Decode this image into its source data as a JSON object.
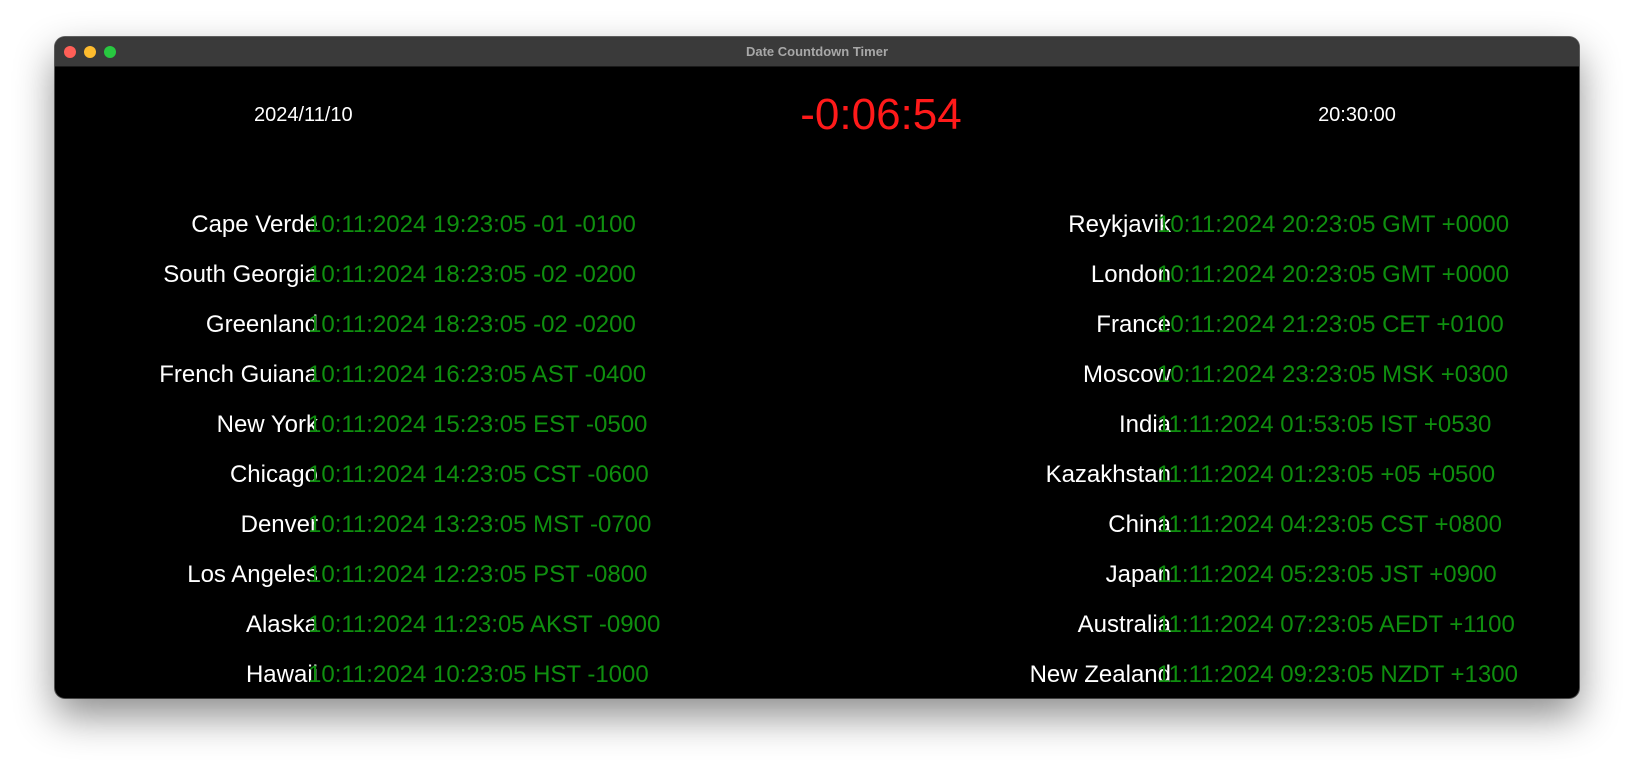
{
  "window": {
    "title": "Date Countdown Timer",
    "traffic_colors": {
      "close": "#ff5f57",
      "minimize": "#febc2e",
      "maximize": "#28c840"
    }
  },
  "header": {
    "date": "2024/11/10",
    "countdown": "-0:06:54",
    "target_time": "20:30:00"
  },
  "colors": {
    "background": "#000000",
    "city_text": "#ffffff",
    "zone_text": "#0f8f0f",
    "countdown_text": "#ff1a1a"
  },
  "left_zones": [
    {
      "city": "Cape Verde",
      "time": "10:11:2024 19:23:05 -01 -0100"
    },
    {
      "city": "South Georgia",
      "time": "10:11:2024 18:23:05 -02 -0200"
    },
    {
      "city": "Greenland",
      "time": "10:11:2024 18:23:05 -02 -0200"
    },
    {
      "city": "French Guiana",
      "time": "10:11:2024 16:23:05 AST -0400"
    },
    {
      "city": "New York",
      "time": "10:11:2024 15:23:05 EST -0500"
    },
    {
      "city": "Chicago",
      "time": "10:11:2024 14:23:05 CST -0600"
    },
    {
      "city": "Denver",
      "time": "10:11:2024 13:23:05 MST -0700"
    },
    {
      "city": "Los Angeles",
      "time": "10:11:2024 12:23:05 PST -0800"
    },
    {
      "city": "Alaska",
      "time": "10:11:2024 11:23:05 AKST -0900"
    },
    {
      "city": "Hawaii",
      "time": "10:11:2024 10:23:05 HST -1000"
    }
  ],
  "right_zones": [
    {
      "city": "Reykjavik",
      "time": "10:11:2024 20:23:05 GMT +0000"
    },
    {
      "city": "London",
      "time": "10:11:2024 20:23:05 GMT +0000"
    },
    {
      "city": "France",
      "time": "10:11:2024 21:23:05 CET +0100"
    },
    {
      "city": "Moscow",
      "time": "10:11:2024 23:23:05 MSK +0300"
    },
    {
      "city": "India",
      "time": "11:11:2024 01:53:05 IST +0530"
    },
    {
      "city": "Kazakhstan",
      "time": "11:11:2024 01:23:05 +05 +0500"
    },
    {
      "city": "China",
      "time": "11:11:2024 04:23:05 CST +0800"
    },
    {
      "city": "Japan",
      "time": "11:11:2024 05:23:05 JST +0900"
    },
    {
      "city": "Australia",
      "time": "11:11:2024 07:23:05 AEDT +1100"
    },
    {
      "city": "New Zealand",
      "time": "11:11:2024 09:23:05 NZDT +1300"
    }
  ]
}
